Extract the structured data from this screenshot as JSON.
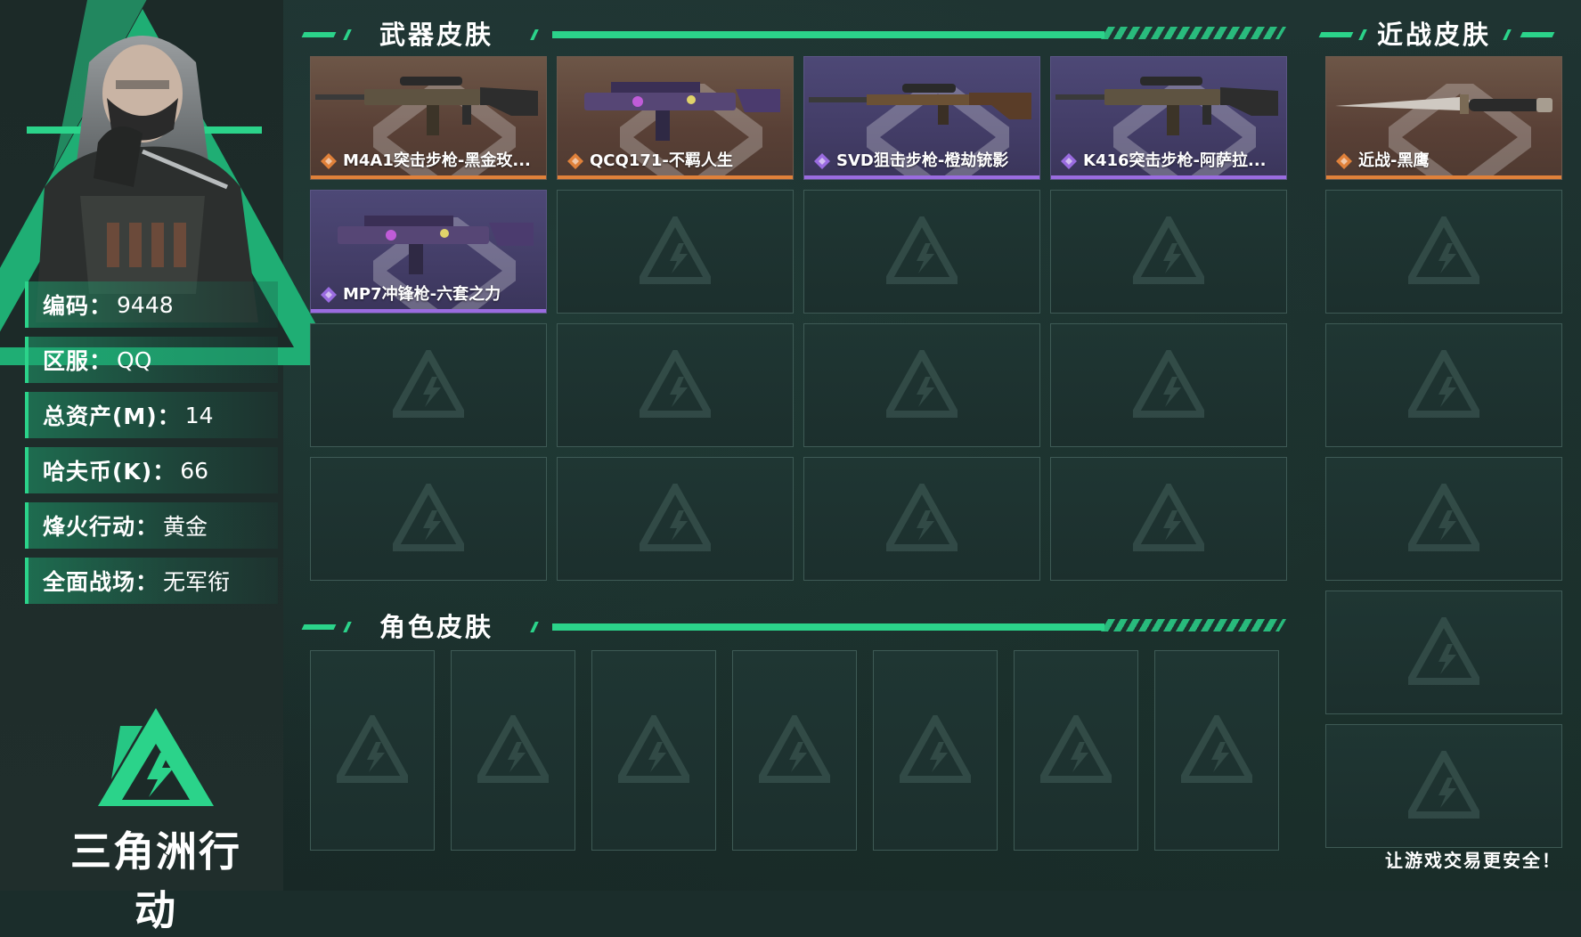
{
  "account": {
    "rows": [
      {
        "key": "编码",
        "value": "9448"
      },
      {
        "key": "区服",
        "value": "QQ"
      },
      {
        "key": "总资产(M)",
        "value": "14"
      },
      {
        "key": "哈夫币(K)",
        "value": "66"
      },
      {
        "key": "烽火行动",
        "value": "黄金"
      },
      {
        "key": "全面战场",
        "value": "无军衔"
      }
    ],
    "separator": "："
  },
  "brand": {
    "name": "三角洲行动"
  },
  "weapon_section": {
    "title": "武器皮肤",
    "items": [
      {
        "label": "M4A1突击步枪-黑金玫...",
        "rarity": "gold",
        "icon": "rifle-icon"
      },
      {
        "label": "QCQ171-不羁人生",
        "rarity": "gold",
        "icon": "smg-icon"
      },
      {
        "label": "SVD狙击步枪-橙劫铳影",
        "rarity": "purple",
        "icon": "sniper-icon"
      },
      {
        "label": "K416突击步枪-阿萨拉...",
        "rarity": "purple",
        "icon": "rifle-icon"
      },
      {
        "label": "MP7冲锋枪-六套之力",
        "rarity": "purple",
        "icon": "smg-icon"
      }
    ],
    "total_slots": 16
  },
  "melee_section": {
    "title": "近战皮肤",
    "items": [
      {
        "label": "近战-黑鹰",
        "rarity": "gold",
        "icon": "knife-icon"
      }
    ],
    "total_slots": 6
  },
  "character_section": {
    "title": "角色皮肤",
    "total_slots": 7
  },
  "tagline": "让游戏交易更安全！",
  "colors": {
    "accent": "#2bd38a",
    "gold_rarity": "#e0813a",
    "purple_rarity": "#9a6ce0",
    "background": "#1b2d2b"
  }
}
